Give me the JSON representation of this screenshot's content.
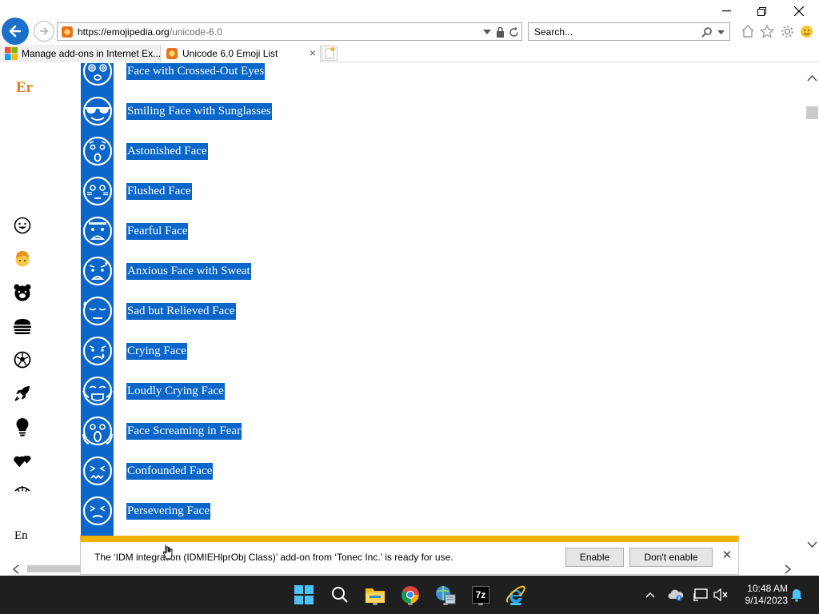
{
  "browser": {
    "address": {
      "url_main": "https://emojipedia.org",
      "url_rest": "/unicode-6.0"
    },
    "search": {
      "placeholder": "Search..."
    },
    "tabs": [
      {
        "label": "Manage add-ons in Internet Ex..."
      },
      {
        "label": "Unicode 6.0 Emoji List",
        "active": true
      }
    ]
  },
  "page": {
    "logo_text": "Er",
    "language_label": "En",
    "sidebar_categories": [
      "smileys-icon",
      "people-icon",
      "animals-icon",
      "food-icon",
      "activity-icon",
      "travel-icon",
      "objects-icon",
      "symbols-icon",
      "flags-icon"
    ],
    "emoji_list": [
      {
        "name": "Face with Crossed-Out Eyes",
        "icon": "dizzy-face-icon"
      },
      {
        "name": "Smiling Face with Sunglasses",
        "icon": "sunglasses-face-icon"
      },
      {
        "name": "Astonished Face",
        "icon": "astonished-face-icon"
      },
      {
        "name": "Flushed Face",
        "icon": "flushed-face-icon"
      },
      {
        "name": "Fearful Face",
        "icon": "fearful-face-icon"
      },
      {
        "name": "Anxious Face with Sweat",
        "icon": "anxious-sweat-face-icon"
      },
      {
        "name": "Sad but Relieved Face",
        "icon": "sad-relieved-face-icon"
      },
      {
        "name": "Crying Face",
        "icon": "crying-face-icon"
      },
      {
        "name": "Loudly Crying Face",
        "icon": "loudly-crying-face-icon"
      },
      {
        "name": "Face Screaming in Fear",
        "icon": "screaming-face-icon"
      },
      {
        "name": "Confounded Face",
        "icon": "confounded-face-icon"
      },
      {
        "name": "Persevering Face",
        "icon": "persevering-face-icon"
      }
    ],
    "selection_color": "#0a66c8",
    "accent_color": "#e07b1a"
  },
  "notification": {
    "message": "The ‘IDM integration (IDMIEHlprObj Class)’ add-on from ‘Tonec Inc.’ is ready for use.",
    "enable_label": "Enable",
    "dont_enable_label": "Don't enable",
    "bar_color": "#f0b400"
  },
  "taskbar": {
    "apps": [
      "start-icon",
      "search-icon",
      "file-explorer-icon",
      "chrome-icon",
      "network-app-icon",
      "7zip-icon",
      "internet-explorer-icon"
    ],
    "seven_zip_label": "7z",
    "time": "10:48 AM",
    "date": "9/14/2023"
  }
}
